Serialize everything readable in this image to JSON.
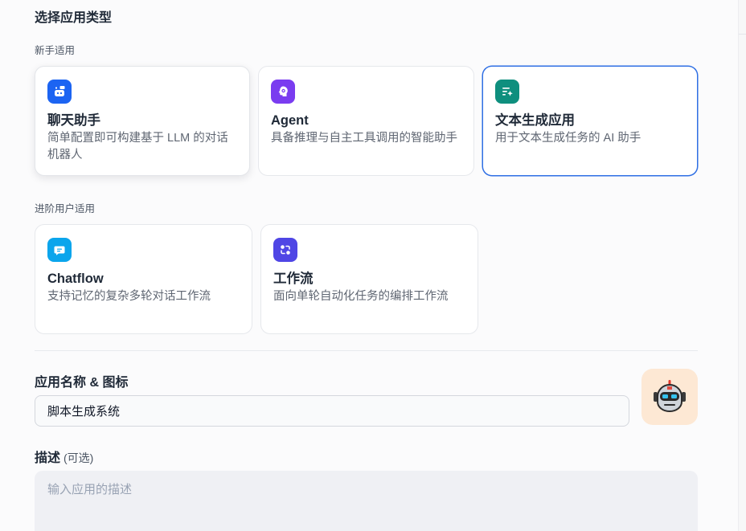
{
  "section_title": "选择应用类型",
  "groups": {
    "beginner": "新手适用",
    "advanced": "进阶用户适用"
  },
  "cards": [
    {
      "title": "聊天助手",
      "desc": "简单配置即可构建基于 LLM 的对话机器人",
      "icon": "chat-bot-icon",
      "color": "#1c64f2",
      "state": "hover"
    },
    {
      "title": "Agent",
      "desc": "具备推理与自主工具调用的智能助手",
      "icon": "agent-brain-icon",
      "color": "#7a3cf0",
      "state": "normal"
    },
    {
      "title": "文本生成应用",
      "desc": "用于文本生成任务的 AI 助手",
      "icon": "text-generator-icon",
      "color": "#0e8f7e",
      "state": "selected"
    },
    {
      "title": "Chatflow",
      "desc": "支持记忆的复杂多轮对话工作流",
      "icon": "chatflow-icon",
      "color": "#0ba5ec",
      "state": "normal"
    },
    {
      "title": "工作流",
      "desc": "面向单轮自动化任务的编排工作流",
      "icon": "workflow-icon",
      "color": "#4f46e5",
      "state": "normal"
    }
  ],
  "name_field": {
    "label": "应用名称 & 图标",
    "value": "脚本生成系统",
    "icon": "robot-avatar-icon",
    "icon_bg": "#fde8d4"
  },
  "desc_field": {
    "label": "描述",
    "optional": "(可选)",
    "placeholder": "输入应用的描述"
  },
  "colors": {
    "selected_border": "#2f6fe4",
    "page_bg": "#fbfbfc"
  }
}
